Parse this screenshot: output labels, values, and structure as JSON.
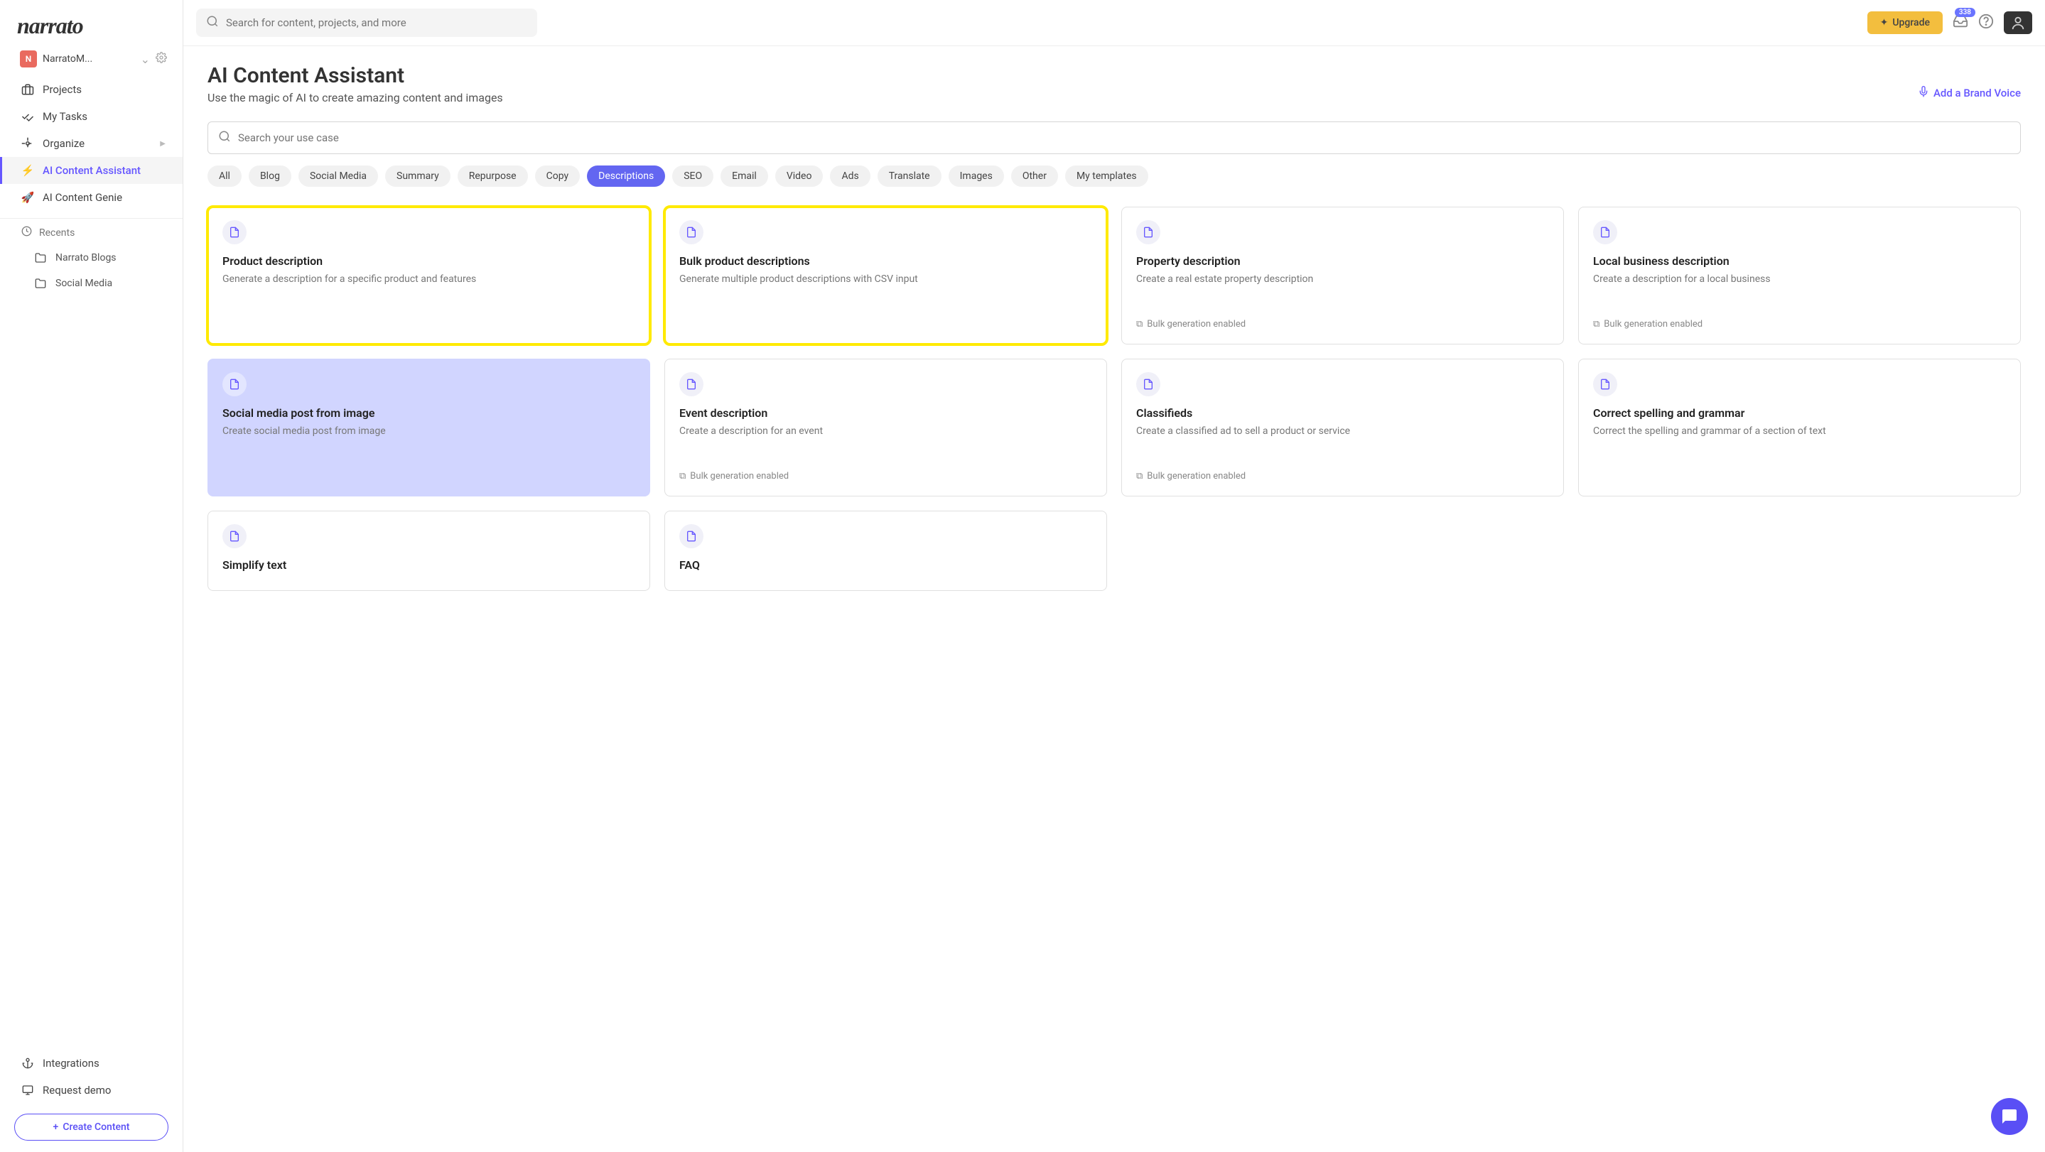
{
  "brand": "narrato",
  "workspace": {
    "initial": "N",
    "name": "NarratoM..."
  },
  "nav": {
    "projects": "Projects",
    "my_tasks": "My Tasks",
    "organize": "Organize",
    "ai_assistant": "AI Content Assistant",
    "ai_genie": "AI Content Genie"
  },
  "recents": {
    "header": "Recents",
    "item1": "Narrato Blogs",
    "item2": "Social Media"
  },
  "bottom": {
    "integrations": "Integrations",
    "request_demo": "Request demo",
    "create_content": "Create Content"
  },
  "topbar": {
    "search_placeholder": "Search for content, projects, and more",
    "upgrade": "Upgrade",
    "badge": "338"
  },
  "page": {
    "title": "AI Content Assistant",
    "subtitle": "Use the magic of AI to create amazing content and images",
    "brand_voice": "Add a Brand Voice",
    "usecase_placeholder": "Search your use case"
  },
  "filters": {
    "all": "All",
    "blog": "Blog",
    "social": "Social Media",
    "summary": "Summary",
    "repurpose": "Repurpose",
    "copy": "Copy",
    "descriptions": "Descriptions",
    "seo": "SEO",
    "email": "Email",
    "video": "Video",
    "ads": "Ads",
    "translate": "Translate",
    "images": "Images",
    "other": "Other",
    "my_templates": "My templates"
  },
  "cards": [
    {
      "title": "Product description",
      "desc": "Generate a description for a specific product and features"
    },
    {
      "title": "Bulk product descriptions",
      "desc": "Generate multiple product descriptions with CSV input"
    },
    {
      "title": "Property description",
      "desc": "Create a real estate property description",
      "bulk": "Bulk generation enabled"
    },
    {
      "title": "Local business description",
      "desc": "Create a description for a local business",
      "bulk": "Bulk generation enabled"
    },
    {
      "title": "Social media post from image",
      "desc": "Create social media post from image"
    },
    {
      "title": "Event description",
      "desc": "Create a description for an event",
      "bulk": "Bulk generation enabled"
    },
    {
      "title": "Classifieds",
      "desc": "Create a classified ad to sell a product or service",
      "bulk": "Bulk generation enabled"
    },
    {
      "title": "Correct spelling and grammar",
      "desc": "Correct the spelling and grammar of a section of text"
    },
    {
      "title": "Simplify text",
      "desc": ""
    },
    {
      "title": "FAQ",
      "desc": ""
    }
  ]
}
